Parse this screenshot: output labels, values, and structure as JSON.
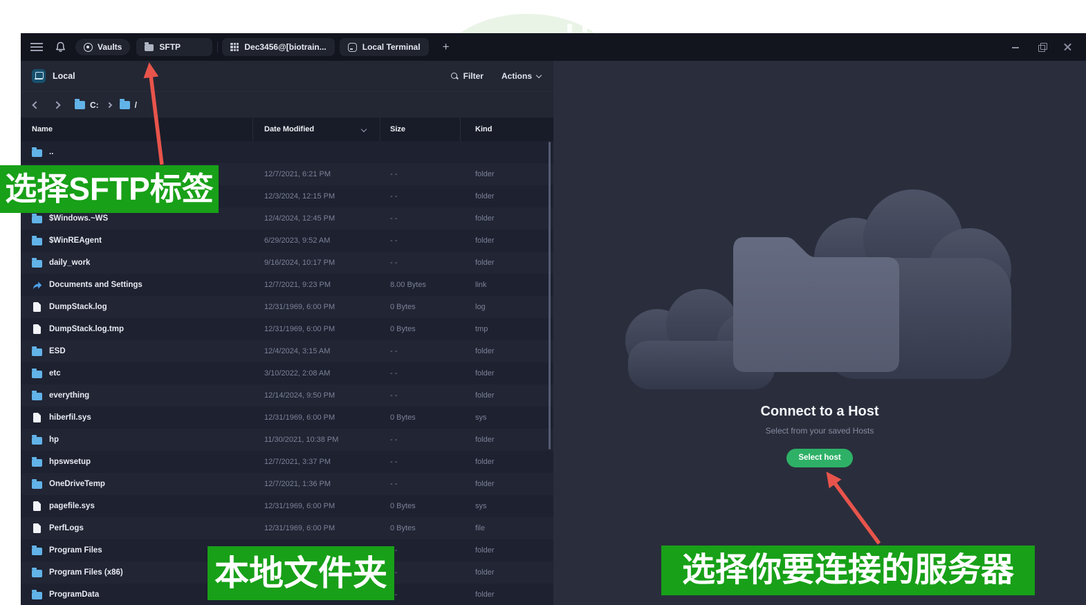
{
  "titlebar": {
    "vaults_label": "Vaults",
    "tabs": [
      {
        "label": "SFTP",
        "icon": "folder-icon"
      },
      {
        "label": "Dec3456@[biotrain...",
        "icon": "server-grid-icon"
      },
      {
        "label": "Local Terminal",
        "icon": "terminal-window-icon"
      }
    ],
    "new_tab_label": "+",
    "icons": {
      "menu": "hamburger",
      "notifications": "bell",
      "vault": "safe-dial",
      "minimize": "dash",
      "maximize": "overlap-squares",
      "close": "x"
    }
  },
  "left_panel": {
    "title": "Local",
    "filter_label": "Filter",
    "actions_label": "Actions",
    "icons": {
      "panel_badge": "laptop",
      "filter": "magnifier",
      "actions_caret": "chevron-down",
      "back": "chevron-left",
      "forward": "chevron-right",
      "breadcrumb_folder": "folder-blue",
      "sort": "chevron-down"
    },
    "breadcrumb": {
      "drive": "C:",
      "path": "/"
    },
    "table": {
      "headers": [
        "Name",
        "Date Modified",
        "Size",
        "Kind"
      ],
      "rows": [
        {
          "name": "..",
          "icon": "folder",
          "date": "",
          "size": "",
          "kind": ""
        },
        {
          "name": "",
          "icon": "folder",
          "date": "12/7/2021, 6:21 PM",
          "size": "- -",
          "kind": "folder"
        },
        {
          "name": "",
          "icon": "folder",
          "date": "12/3/2024, 12:15 PM",
          "size": "- -",
          "kind": "folder"
        },
        {
          "name": "$Windows.~WS",
          "icon": "folder",
          "date": "12/4/2024, 12:45 PM",
          "size": "- -",
          "kind": "folder"
        },
        {
          "name": "$WinREAgent",
          "icon": "folder",
          "date": "6/29/2023, 9:52 AM",
          "size": "- -",
          "kind": "folder"
        },
        {
          "name": "daily_work",
          "icon": "folder",
          "date": "9/16/2024, 10:17 PM",
          "size": "- -",
          "kind": "folder"
        },
        {
          "name": "Documents and Settings",
          "icon": "link",
          "date": "12/7/2021, 9:23 PM",
          "size": "8.00 Bytes",
          "kind": "link"
        },
        {
          "name": "DumpStack.log",
          "icon": "file",
          "date": "12/31/1969, 6:00 PM",
          "size": "0 Bytes",
          "kind": "log"
        },
        {
          "name": "DumpStack.log.tmp",
          "icon": "file",
          "date": "12/31/1969, 6:00 PM",
          "size": "0 Bytes",
          "kind": "tmp"
        },
        {
          "name": "ESD",
          "icon": "folder",
          "date": "12/4/2024, 3:15 AM",
          "size": "- -",
          "kind": "folder"
        },
        {
          "name": "etc",
          "icon": "folder",
          "date": "3/10/2022, 2:08 AM",
          "size": "- -",
          "kind": "folder"
        },
        {
          "name": "everything",
          "icon": "folder",
          "date": "12/14/2024, 9:50 PM",
          "size": "- -",
          "kind": "folder"
        },
        {
          "name": "hiberfil.sys",
          "icon": "file",
          "date": "12/31/1969, 6:00 PM",
          "size": "0 Bytes",
          "kind": "sys"
        },
        {
          "name": "hp",
          "icon": "folder",
          "date": "11/30/2021, 10:38 PM",
          "size": "- -",
          "kind": "folder"
        },
        {
          "name": "hpswsetup",
          "icon": "folder",
          "date": "12/7/2021, 3:37 PM",
          "size": "- -",
          "kind": "folder"
        },
        {
          "name": "OneDriveTemp",
          "icon": "folder",
          "date": "12/7/2021, 1:36 PM",
          "size": "- -",
          "kind": "folder"
        },
        {
          "name": "pagefile.sys",
          "icon": "file",
          "date": "12/31/1969, 6:00 PM",
          "size": "0 Bytes",
          "kind": "sys"
        },
        {
          "name": "PerfLogs",
          "icon": "file",
          "date": "12/31/1969, 6:00 PM",
          "size": "0 Bytes",
          "kind": "file"
        },
        {
          "name": "Program Files",
          "icon": "folder",
          "date": "",
          "size": "- -",
          "kind": "folder"
        },
        {
          "name": "Program Files (x86)",
          "icon": "folder",
          "date": "",
          "size": "- -",
          "kind": "folder"
        },
        {
          "name": "ProgramData",
          "icon": "folder",
          "date": "",
          "size": "- -",
          "kind": "folder"
        }
      ]
    }
  },
  "right_panel": {
    "title": "Connect to a Host",
    "subtitle": "Select from your saved Hosts",
    "select_host_label": "Select host",
    "illustration": "clouds-and-folder"
  },
  "annotations": {
    "sftp_tab": "选择SFTP标签",
    "local_folder": "本地文件夹",
    "select_server": "选择你要连接的服务器"
  },
  "colors": {
    "annotation_green": "#18a018",
    "arrow_red": "#e8544b",
    "button_green": "#2eb167",
    "folder_blue": "#62b3e8",
    "titlebar_bg": "#12141e",
    "left_panel_bg": "#1d2130",
    "right_panel_bg": "#2a2e3c"
  }
}
